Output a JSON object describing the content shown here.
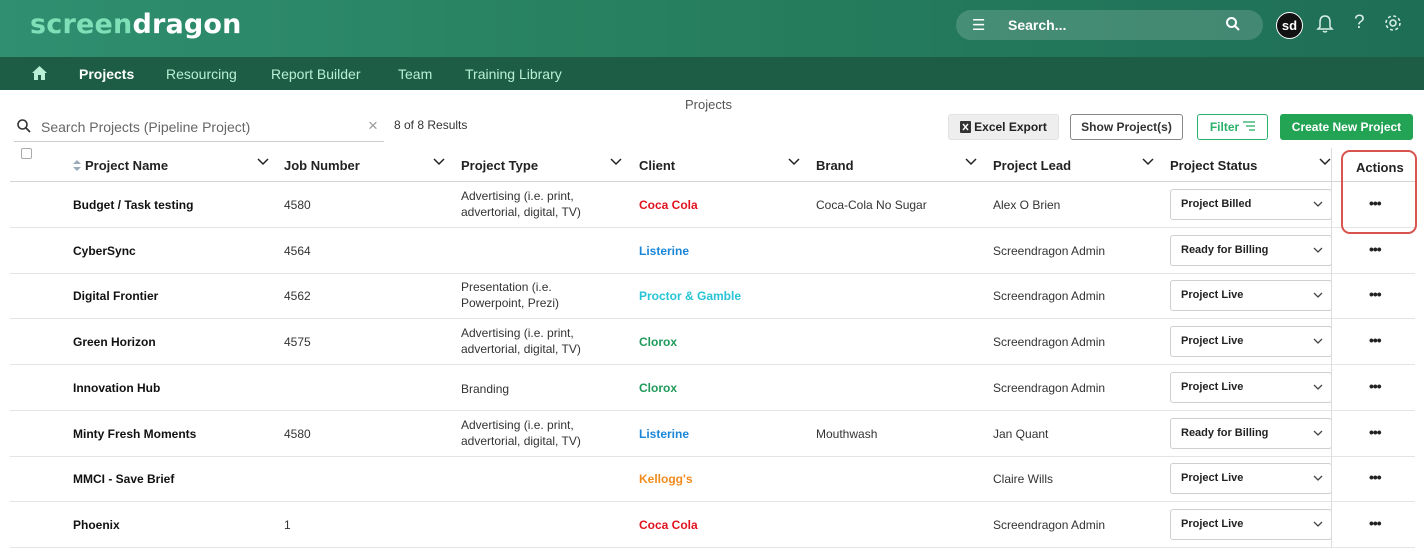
{
  "header": {
    "logo_part1": "screen",
    "logo_part2": "dragon",
    "search_placeholder": "Search...",
    "avatar_initials": "sd"
  },
  "nav": {
    "items": [
      {
        "label": "Projects",
        "active": true
      },
      {
        "label": "Resourcing"
      },
      {
        "label": "Report Builder"
      },
      {
        "label": "Team"
      },
      {
        "label": "Training Library"
      }
    ]
  },
  "toolbar": {
    "page_title": "Projects",
    "search_placeholder": "Search  Projects (Pipeline Project)",
    "results": "8 of 8 Results",
    "excel_label": "Excel Export",
    "show_label": "Show Project(s)",
    "filter_label": "Filter",
    "create_label": "Create New Project"
  },
  "table": {
    "columns": {
      "name": "Project Name",
      "job": "Job Number",
      "type": "Project Type",
      "client": "Client",
      "brand": "Brand",
      "lead": "Project Lead",
      "status": "Project Status",
      "actions": "Actions"
    },
    "rows": [
      {
        "name": "Budget / Task testing",
        "job": "4580",
        "type1": "Advertising (i.e. print,",
        "type2": "advertorial, digital, TV)",
        "client": "Coca Cola",
        "client_color": "#e0141e",
        "brand": "Coca-Cola No Sugar",
        "lead": "Alex O Brien",
        "status": "Project Billed"
      },
      {
        "name": "CyberSync",
        "job": "4564",
        "type1": "",
        "type2": "",
        "client": "Listerine",
        "client_color": "#1a86d8",
        "brand": "",
        "lead": "Screendragon Admin",
        "status": "Ready for Billing"
      },
      {
        "name": "Digital Frontier",
        "job": "4562",
        "type1": "Presentation (i.e.",
        "type2": "Powerpoint, Prezi)",
        "client": "Proctor & Gamble",
        "client_color": "#27c4d6",
        "brand": "",
        "lead": "Screendragon Admin",
        "status": "Project Live"
      },
      {
        "name": "Green Horizon",
        "job": "4575",
        "type1": "Advertising (i.e. print,",
        "type2": "advertorial, digital, TV)",
        "client": "Clorox",
        "client_color": "#1f9a5a",
        "brand": "",
        "lead": "Screendragon Admin",
        "status": "Project Live"
      },
      {
        "name": "Innovation Hub",
        "job": "",
        "type1": "Branding",
        "type2": "",
        "client": "Clorox",
        "client_color": "#1f9a5a",
        "brand": "",
        "lead": "Screendragon Admin",
        "status": "Project Live"
      },
      {
        "name": "Minty Fresh Moments",
        "job": "4580",
        "type1": "Advertising (i.e. print,",
        "type2": "advertorial, digital, TV)",
        "client": "Listerine",
        "client_color": "#1a86d8",
        "brand": "Mouthwash",
        "lead": "Jan Quant",
        "status": "Ready for Billing"
      },
      {
        "name": "MMCI - Save Brief",
        "job": "",
        "type1": "",
        "type2": "",
        "client": "Kellogg's",
        "client_color": "#f08c1e",
        "brand": "",
        "lead": "Claire Wills",
        "status": "Project Live"
      },
      {
        "name": "Phoenix",
        "job": "1",
        "type1": "",
        "type2": "",
        "client": "Coca Cola",
        "client_color": "#e0141e",
        "brand": "",
        "lead": "Screendragon Admin",
        "status": "Project Live"
      }
    ]
  },
  "colors": {
    "header": "#2a8666",
    "nav": "#1d5d46",
    "accent": "#23a455",
    "highlight": "#d9534f"
  }
}
